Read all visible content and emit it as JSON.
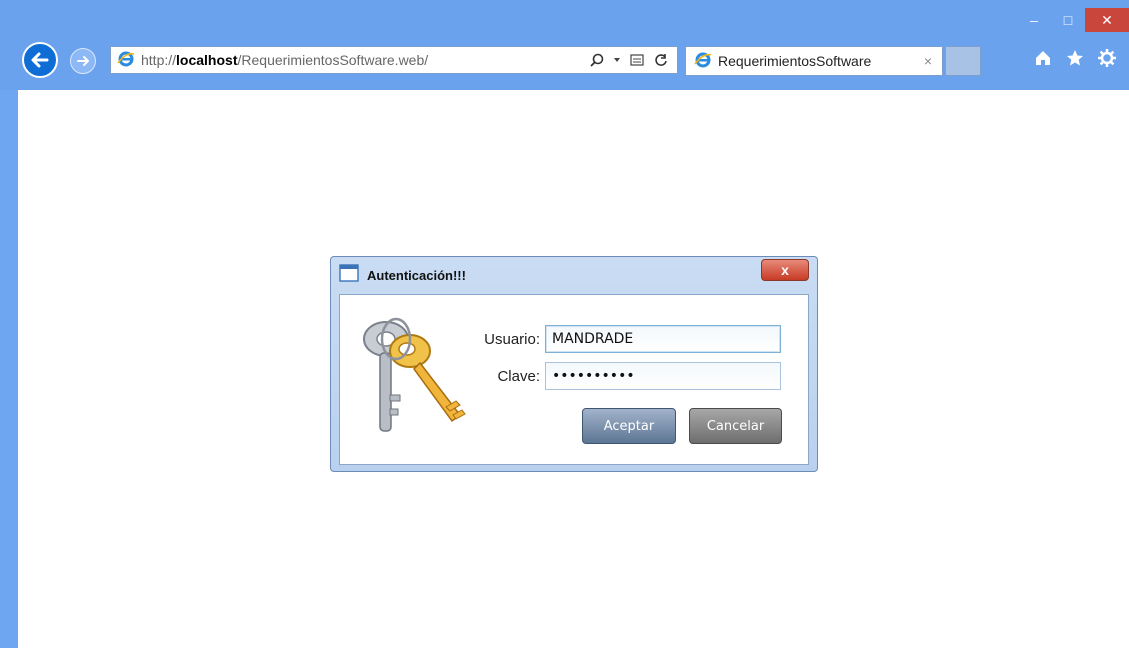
{
  "window": {
    "minimize_glyph": "–",
    "maximize_glyph": "□",
    "close_glyph": "✕"
  },
  "browser": {
    "address_prefix": "http://",
    "address_host": "localhost",
    "address_path": "/RequerimientosSoftware.web/",
    "tab_title": "RequerimientosSoftware",
    "tab_close_glyph": "×",
    "icons": [
      "back-icon",
      "forward-icon",
      "ie-icon",
      "search-icon",
      "compat-icon",
      "refresh-icon",
      "home-icon",
      "favorites-star-icon",
      "settings-gear-icon"
    ]
  },
  "dialog": {
    "title": "Autenticación!!!",
    "close_glyph": "x",
    "user_label": "Usuario:",
    "user_value": "MANDRADE",
    "password_label": "Clave:",
    "password_value": "••••••••••",
    "accept_label": "Aceptar",
    "cancel_label": "Cancelar"
  },
  "colors": {
    "chrome": "#6aa2ee",
    "dialog_close": "#c83b25",
    "accept_button": "#5c7594",
    "cancel_button": "#6e6e6e"
  }
}
